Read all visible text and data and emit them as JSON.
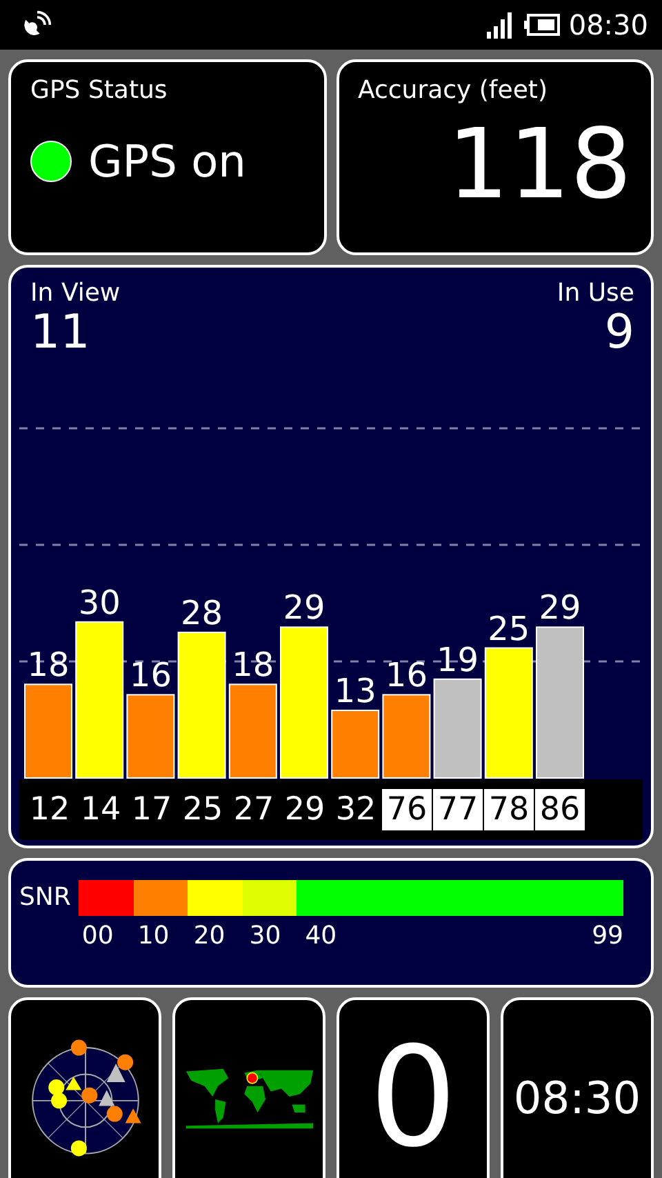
{
  "status_bar": {
    "time": "08:30"
  },
  "gps_status": {
    "title": "GPS Status",
    "text": "GPS on",
    "on": true
  },
  "accuracy": {
    "title": "Accuracy (feet)",
    "value": "118"
  },
  "satellites_panel": {
    "in_view_label": "In View",
    "in_view": "11",
    "in_use_label": "In Use",
    "in_use": "9",
    "chart_data": {
      "type": "bar",
      "categories": [
        "12",
        "14",
        "17",
        "25",
        "27",
        "29",
        "32",
        "76",
        "77",
        "78",
        "86"
      ],
      "values": [
        18,
        30,
        16,
        28,
        18,
        29,
        13,
        16,
        19,
        25,
        29
      ],
      "data_labels": true
    },
    "satellites": [
      {
        "color": "#ff8000",
        "boxed": false
      },
      {
        "color": "#ffff00",
        "boxed": false
      },
      {
        "color": "#ff8000",
        "boxed": false
      },
      {
        "color": "#ffff00",
        "boxed": false
      },
      {
        "color": "#ff8000",
        "boxed": false
      },
      {
        "color": "#ffff00",
        "boxed": false
      },
      {
        "color": "#ff8000",
        "boxed": false
      },
      {
        "color": "#ff8000",
        "boxed": true
      },
      {
        "color": "#c0c0c0",
        "boxed": true
      },
      {
        "color": "#ffff00",
        "boxed": true
      },
      {
        "color": "#c0c0c0",
        "boxed": true
      }
    ]
  },
  "snr_legend": {
    "label": "SNR",
    "segments": [
      {
        "color": "#ff0000",
        "label": "00"
      },
      {
        "color": "#ff8000",
        "label": "10"
      },
      {
        "color": "#ffff00",
        "label": "20"
      },
      {
        "color": "#ddff00",
        "label": "30"
      },
      {
        "color": "#00ff00",
        "label": "40"
      }
    ],
    "end_label": "99"
  },
  "tiles": {
    "count": "0",
    "time": "08:30"
  }
}
